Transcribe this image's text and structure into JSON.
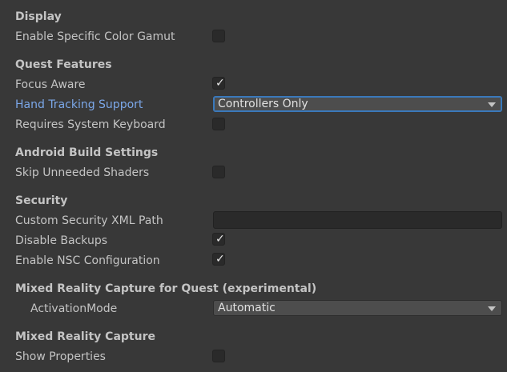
{
  "sections": {
    "display": {
      "header": "Display",
      "enable_color_gamut_label": "Enable Specific Color Gamut",
      "enable_color_gamut_checked": false
    },
    "quest_features": {
      "header": "Quest Features",
      "focus_aware_label": "Focus Aware",
      "focus_aware_checked": true,
      "hand_tracking_label": "Hand Tracking Support",
      "hand_tracking_value": "Controllers Only",
      "system_keyboard_label": "Requires System Keyboard",
      "system_keyboard_checked": false
    },
    "android_build": {
      "header": "Android Build Settings",
      "skip_shaders_label": "Skip Unneeded Shaders",
      "skip_shaders_checked": false
    },
    "security": {
      "header": "Security",
      "xml_path_label": "Custom Security XML Path",
      "xml_path_value": "",
      "disable_backups_label": "Disable Backups",
      "disable_backups_checked": true,
      "nsc_label": "Enable NSC Configuration",
      "nsc_checked": true
    },
    "mrc_quest": {
      "header": "Mixed Reality Capture for Quest (experimental)",
      "activation_mode_label": "ActivationMode",
      "activation_mode_value": "Automatic"
    },
    "mrc": {
      "header": "Mixed Reality Capture",
      "show_properties_label": "Show Properties",
      "show_properties_checked": false
    }
  },
  "check_glyph": "✓",
  "colors": {
    "background": "#383838",
    "label": "#c4c4c4",
    "highlight_label": "#7ba7e8",
    "focus_border": "#3a79bb"
  }
}
